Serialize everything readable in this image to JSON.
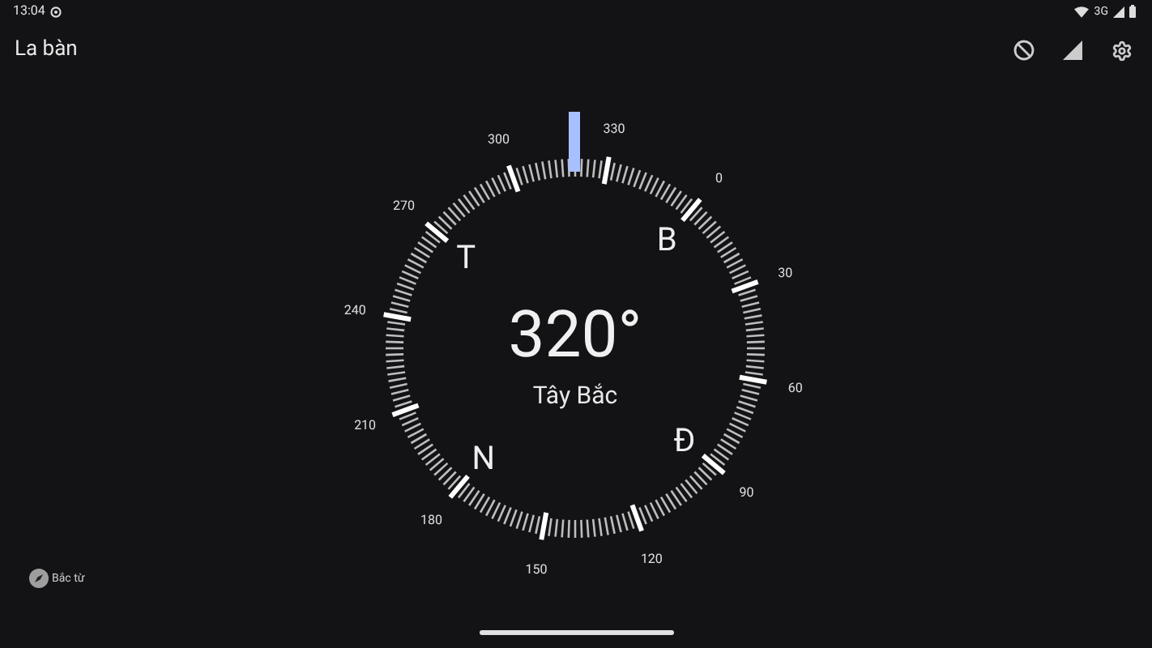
{
  "status_bar": {
    "time": "13:04",
    "network": "3G"
  },
  "app_bar": {
    "title": "La bàn"
  },
  "compass": {
    "heading": "320°",
    "direction": "Tây Bắc",
    "dial_labels": [
      "0",
      "30",
      "60",
      "90",
      "120",
      "150",
      "180",
      "210",
      "240",
      "270",
      "300",
      "330"
    ],
    "cardinals": [
      "T",
      "B",
      "N",
      "Đ"
    ]
  },
  "footer": {
    "label": "Bắc từ"
  }
}
